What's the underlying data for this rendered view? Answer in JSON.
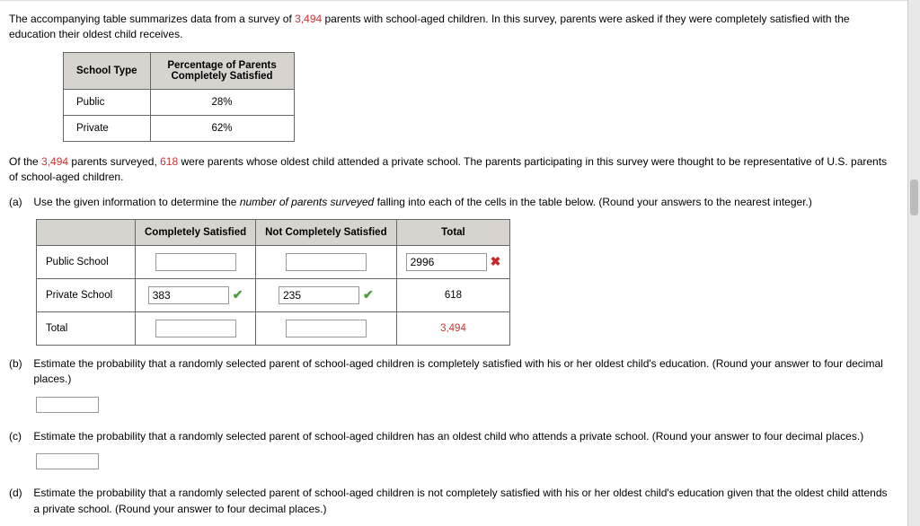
{
  "intro": {
    "text1a": "The accompanying table summarizes data from a survey of ",
    "num1": "3,494",
    "text1b": " parents with school-aged children. In this survey, parents were asked if they were completely satisfied with the education their oldest child receives."
  },
  "satTable": {
    "h1": "School Type",
    "h2": "Percentage of Parents Completely Satisfied",
    "rows": [
      {
        "label": "Public",
        "val": "28%"
      },
      {
        "label": "Private",
        "val": "62%"
      }
    ]
  },
  "para2": {
    "t1": "Of the ",
    "n1": "3,494",
    "t2": " parents surveyed, ",
    "n2": "618",
    "t3": " were parents whose oldest child attended a private school. The parents participating in this survey were thought to be representative of U.S. parents of school-aged children."
  },
  "a": {
    "letter": "(a)",
    "text1": "Use the given information to determine the ",
    "italic": "number of parents surveyed",
    "text2": " falling into each of the cells in the table below. (Round your answers to the nearest integer.)"
  },
  "mainTable": {
    "h_blank": "",
    "h1": "Completely Satisfied",
    "h2": "Not Completely Satisfied",
    "h3": "Total",
    "rows": [
      {
        "label": "Public School",
        "c1": {
          "val": "",
          "mark": ""
        },
        "c2": {
          "val": "",
          "mark": ""
        },
        "c3": {
          "val": "2996",
          "mark": "cross"
        }
      },
      {
        "label": "Private School",
        "c1": {
          "val": "383",
          "mark": "check"
        },
        "c2": {
          "val": "235",
          "mark": "check"
        },
        "c3": {
          "val": "618",
          "mark": "",
          "static": true
        }
      },
      {
        "label": "Total",
        "c1": {
          "val": "",
          "mark": ""
        },
        "c2": {
          "val": "",
          "mark": ""
        },
        "c3": {
          "val": "3,494",
          "mark": "",
          "static": true,
          "red": true
        }
      }
    ]
  },
  "b": {
    "letter": "(b)",
    "text": "Estimate the probability that a randomly selected parent of school-aged children is completely satisfied with his or her oldest child's education. (Round your answer to four decimal places.)"
  },
  "c": {
    "letter": "(c)",
    "text": "Estimate the probability that a randomly selected parent of school-aged children has an oldest child who attends a private school. (Round your answer to four decimal places.)"
  },
  "d": {
    "letter": "(d)",
    "text": "Estimate the probability that a randomly selected parent of school-aged children is not completely satisfied with his or her oldest child's education given that the oldest child attends a private school. (Round your answer to four decimal places.)"
  },
  "marks": {
    "check": "✔",
    "cross": "✖"
  }
}
